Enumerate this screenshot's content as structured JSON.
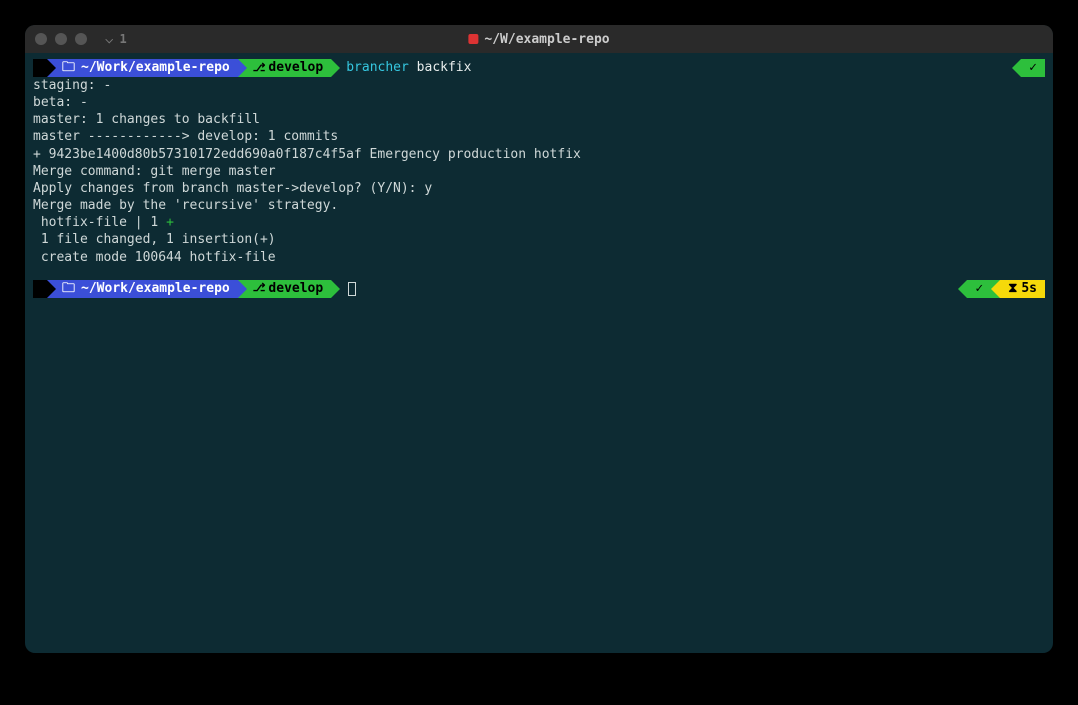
{
  "titlebar": {
    "tab_number": "1",
    "title_path": "~/W/example-repo"
  },
  "prompt1": {
    "path": "~/Work/example-repo",
    "git_label": "git",
    "branch": "develop",
    "cmd_tool": "brancher",
    "cmd_arg": "backfix"
  },
  "output": {
    "l1": "staging: -",
    "l2": "beta: -",
    "l3": "master: 1 changes to backfill",
    "l4": "master ------------> develop: 1 commits",
    "l5": "+ 9423be1400d80b57310172edd690a0f187c4f5af Emergency production hotfix",
    "blank1": "",
    "l6": "Merge command: git merge master",
    "l7": "Apply changes from branch master->develop? (Y/N): y",
    "l8": "Merge made by the 'recursive' strategy.",
    "l9_prefix": " hotfix-file | 1 ",
    "l9_plus": "+",
    "l10": " 1 file changed, 1 insertion(+)",
    "l11": " create mode 100644 hotfix-file"
  },
  "prompt2": {
    "path": "~/Work/example-repo",
    "git_label": "git",
    "branch": "develop",
    "duration": "5s"
  },
  "icons": {
    "check": "✓",
    "hourglass": "⌛",
    "apple": "",
    "folder": "📁"
  }
}
